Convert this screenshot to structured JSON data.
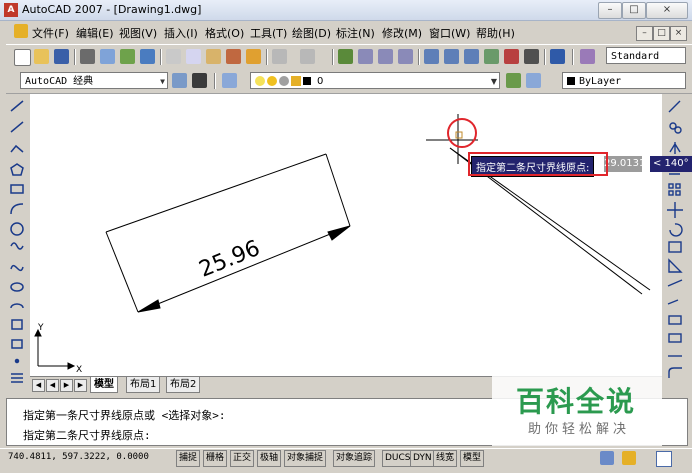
{
  "window": {
    "title": "AutoCAD 2007 - [Drawing1.dwg]",
    "controls": [
      "–",
      "□",
      "×"
    ]
  },
  "menu": {
    "items": [
      "文件(F)",
      "编辑(E)",
      "视图(V)",
      "插入(I)",
      "格式(O)",
      "工具(T)",
      "绘图(D)",
      "标注(N)",
      "修改(M)",
      "窗口(W)",
      "帮助(H)"
    ],
    "mdi_controls": [
      "–",
      "□",
      "×"
    ]
  },
  "toolbar": {
    "text_style": "Standard",
    "workspace": "AutoCAD 经典",
    "layer": "0",
    "color": "ByLayer"
  },
  "drawing": {
    "dimension_text": "25.96",
    "ucs_x": "X",
    "ucs_y": "Y"
  },
  "tooltip": {
    "prompt": "指定第二条尺寸界线原点:",
    "length": "29.0131",
    "angle": "< 140°"
  },
  "tabs": {
    "model": "模型",
    "layout1": "布局1",
    "layout2": "布局2"
  },
  "command": {
    "line1": "指定第一条尺寸界线原点或 <选择对象>:",
    "line2": "指定第二条尺寸界线原点:"
  },
  "status": {
    "coords": "740.4811, 597.3222, 0.0000",
    "buttons": [
      "捕捉",
      "栅格",
      "正交",
      "极轴",
      "对象捕捉",
      "对象追踪",
      "DUCS",
      "DYN",
      "线宽",
      "模型"
    ]
  },
  "watermark": {
    "title": "百科全说",
    "subtitle": "助你轻松解决"
  },
  "colors": {
    "title_bar": "#cfd9ea",
    "canvas": "#ffffff",
    "tooltip_bg": "#23236e",
    "highlight": "#e0262c",
    "watermark_green": "#2b9a4f"
  }
}
